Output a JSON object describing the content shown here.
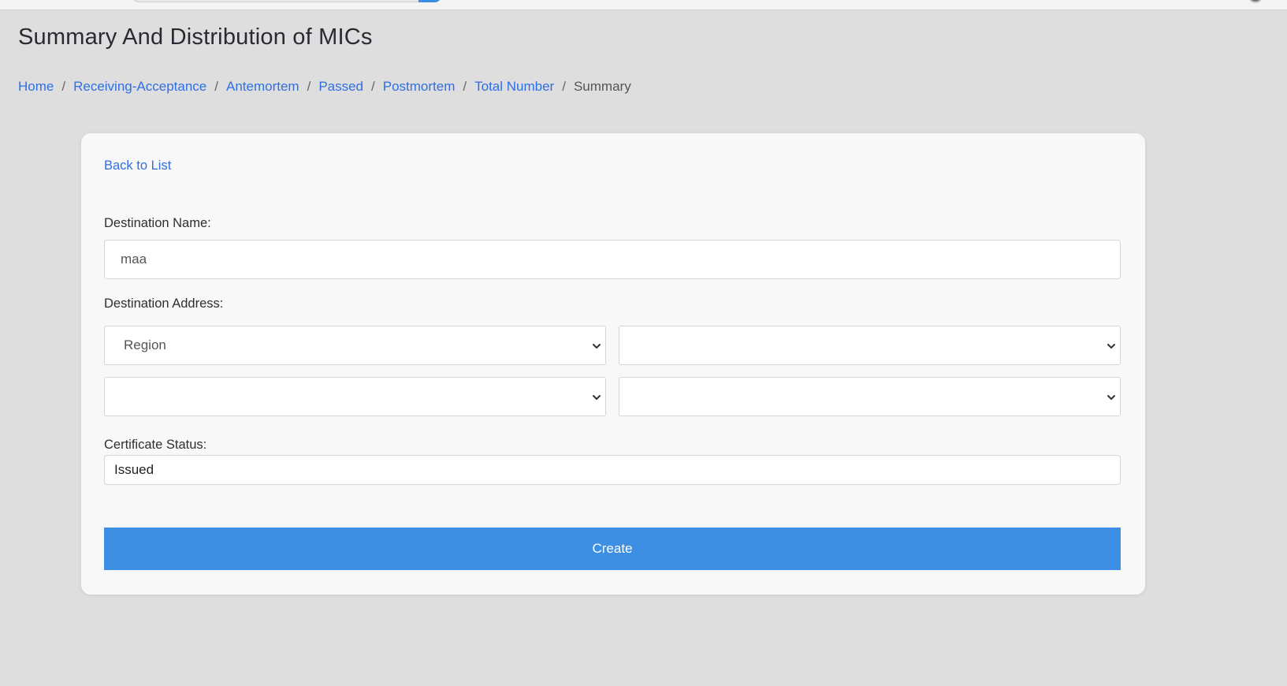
{
  "page": {
    "title": "Summary And Distribution of MICs"
  },
  "breadcrumb": {
    "links": [
      "Home",
      "Receiving-Acceptance",
      "Antemortem",
      "Passed",
      "Postmortem",
      "Total Number"
    ],
    "current": "Summary",
    "separator": "/"
  },
  "form": {
    "back_label": "Back to List",
    "destination_name": {
      "label": "Destination Name:",
      "value": "maa"
    },
    "destination_address": {
      "label": "Destination Address:",
      "selects": [
        {
          "selected": "Region"
        },
        {
          "selected": ""
        },
        {
          "selected": ""
        },
        {
          "selected": ""
        }
      ]
    },
    "certificate_status": {
      "label": "Certificate Status:",
      "value": "Issued"
    },
    "submit_label": "Create"
  },
  "colors": {
    "link": "#2f6fe4",
    "primary_button": "#3d8fe4",
    "background": "#dedede",
    "card": "#f8f8f8"
  }
}
